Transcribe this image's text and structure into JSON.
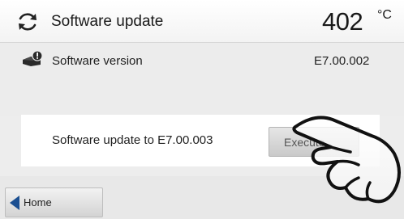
{
  "header": {
    "title": "Software update",
    "temperature": "402",
    "unit": "°C",
    "icon": "refresh-icon"
  },
  "info": {
    "icon": "device-icon",
    "label": "Software version",
    "value": "E7.00.002"
  },
  "update": {
    "label": "Software update to E7.00.003",
    "button_label": "Execute"
  },
  "nav": {
    "home_label": "Home",
    "home_icon": "arrow-left-icon"
  },
  "colors": {
    "accent": "#1b4f91",
    "background": "#ededed"
  }
}
